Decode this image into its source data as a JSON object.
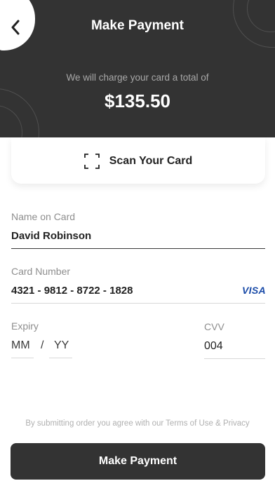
{
  "header": {
    "title": "Make Payment",
    "charge_note": "We will charge your card a total of",
    "amount": "$135.50"
  },
  "scan": {
    "label": "Scan Your Card",
    "icon": "scan-frame-icon"
  },
  "form": {
    "name": {
      "label": "Name on Card",
      "value": "David Robinson"
    },
    "number": {
      "label": "Card Number",
      "value": "4321 - 9812 - 8722 - 1828",
      "brand": "VISA"
    },
    "expiry": {
      "label": "Expiry",
      "month_placeholder": "MM",
      "separator": "/",
      "year_placeholder": "YY"
    },
    "cvv": {
      "label": "CVV",
      "value": "004"
    }
  },
  "footer": {
    "terms": "By submitting order you agree with our Terms of Use & Privacy",
    "button_label": "Make Payment"
  },
  "colors": {
    "header_bg": "#333333",
    "button_bg": "#333333",
    "visa_blue": "#1a4ba8"
  }
}
